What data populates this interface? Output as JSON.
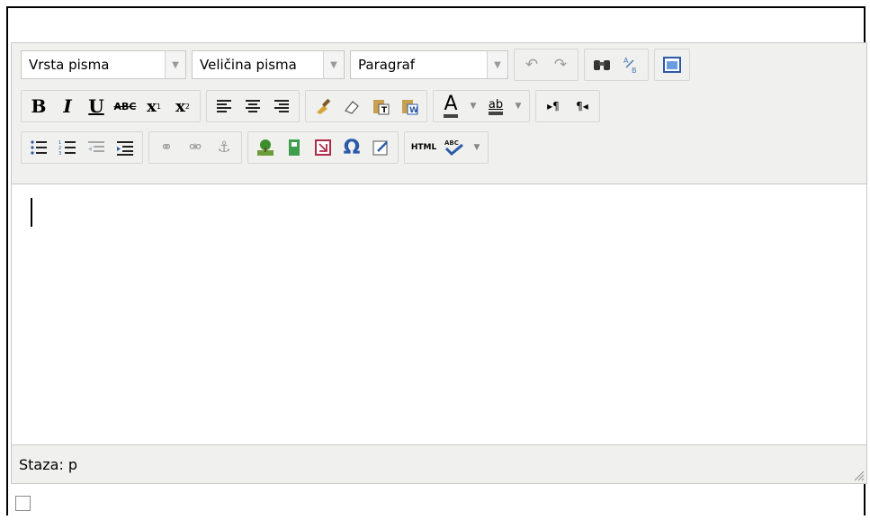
{
  "toolbar": {
    "font_family": {
      "placeholder": "Vrsta pisma"
    },
    "font_size": {
      "placeholder": "Veličina pisma"
    },
    "format": {
      "value": "Paragraf"
    },
    "bold": "B",
    "italic": "I",
    "underline": "U",
    "strikethrough": "ABC",
    "subscript": "x",
    "superscript": "x",
    "font_color": "A",
    "highlight": "ab",
    "omega": "Ω",
    "html": "HTML",
    "spell": "ABC"
  },
  "status": {
    "path_label": "Staza: p"
  },
  "colors": {
    "toolbar_bg": "#f0f0ee",
    "border": "#c8c8c8"
  }
}
